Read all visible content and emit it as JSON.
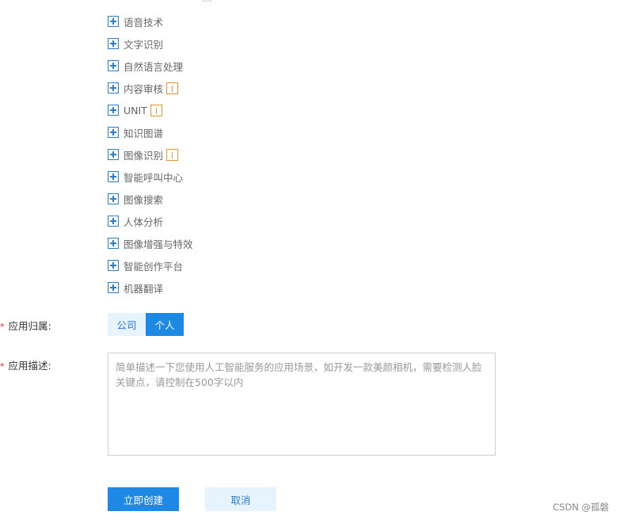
{
  "tree": {
    "items": [
      {
        "label": "语音技术",
        "badge": false
      },
      {
        "label": "文字识别",
        "badge": false
      },
      {
        "label": "自然语言处理",
        "badge": false
      },
      {
        "label": "内容审核",
        "badge": true
      },
      {
        "label": "UNIT",
        "badge": true
      },
      {
        "label": "知识图谱",
        "badge": false
      },
      {
        "label": "图像识别",
        "badge": true
      },
      {
        "label": "智能呼叫中心",
        "badge": false
      },
      {
        "label": "图像搜索",
        "badge": false
      },
      {
        "label": "人体分析",
        "badge": false
      },
      {
        "label": "图像增强与特效",
        "badge": false
      },
      {
        "label": "智能创作平台",
        "badge": false
      },
      {
        "label": "机器翻译",
        "badge": false
      }
    ]
  },
  "form": {
    "ownership": {
      "required_mark": "*",
      "label": "应用归属:",
      "options": [
        "公司",
        "个人"
      ],
      "selected": "个人"
    },
    "description": {
      "required_mark": "*",
      "label": "应用描述:",
      "value": "",
      "placeholder": "简单描述一下您使用人工智能服务的应用场景，如开发一款美颜相机，需要检测人脸关键点，请控制在500字以内"
    }
  },
  "actions": {
    "create_label": "立即创建",
    "cancel_label": "取消"
  },
  "watermark": "CSDN @孤磐",
  "colors": {
    "accent": "#1e88e5",
    "accent_light": "#e8f4fd",
    "badge": "#e8952f",
    "required": "#e0312a"
  },
  "icons": {
    "tree_expand": "plus-square-icon",
    "tree_badge": "exclamation-badge-icon"
  }
}
